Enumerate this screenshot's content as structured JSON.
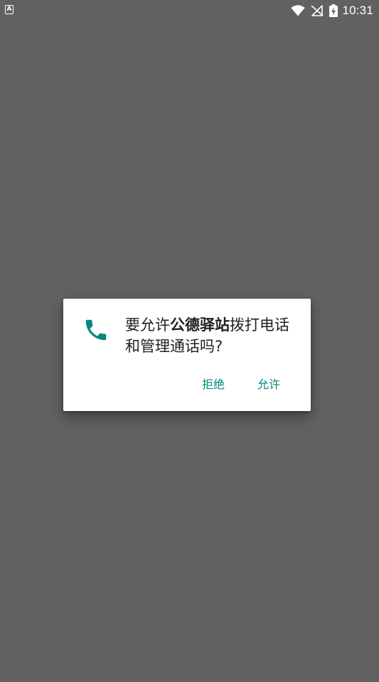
{
  "status_bar": {
    "notification_icon": "font-a-icon",
    "time": "10:31",
    "icons": [
      "wifi-icon",
      "no-signal-icon",
      "battery-charging-icon"
    ]
  },
  "dialog": {
    "icon": "phone-icon",
    "icon_color": "#00897b",
    "message_prefix": "要允许",
    "app_name": "公德驿站",
    "message_suffix": "拨打电话和管理通话吗?",
    "deny_label": "拒绝",
    "allow_label": "允许"
  },
  "colors": {
    "accent": "#00897b",
    "scrim": "#616161"
  }
}
